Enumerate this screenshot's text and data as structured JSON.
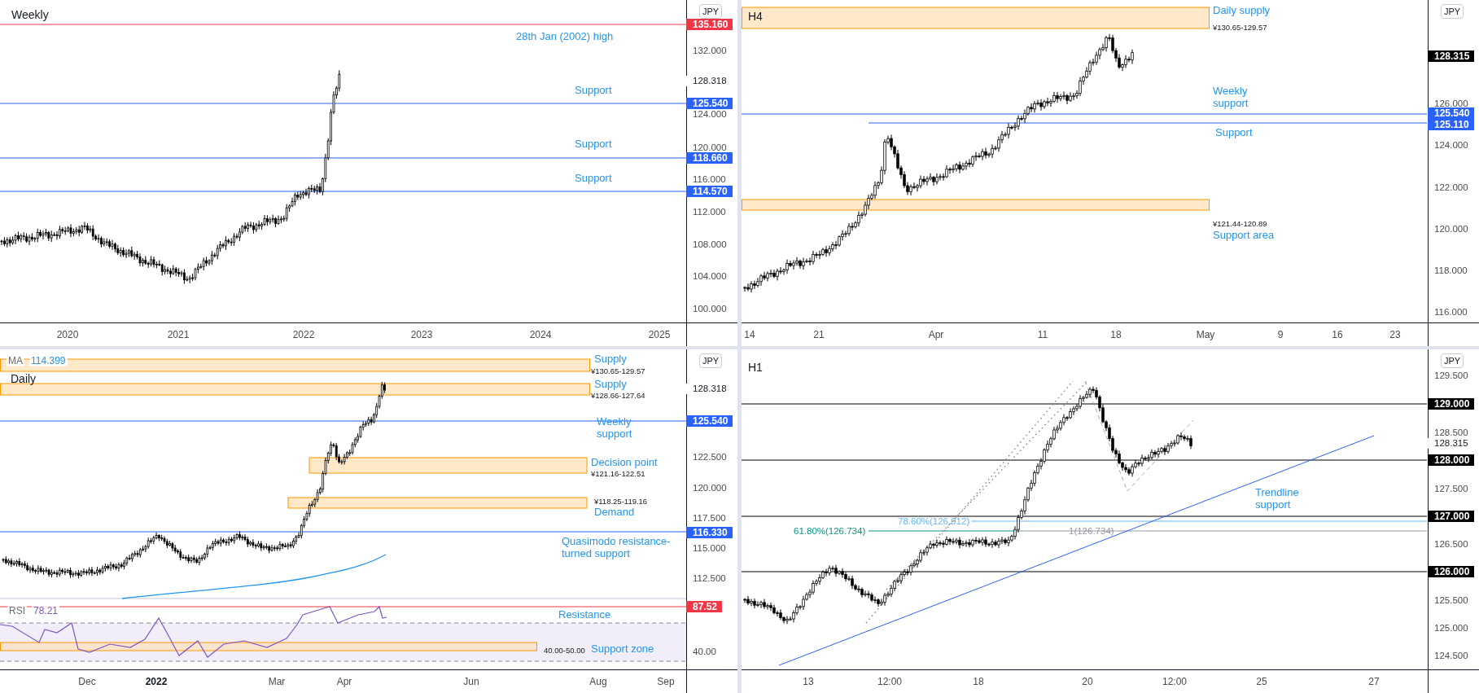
{
  "panels": [
    {
      "timeframe": "Weekly",
      "currency": "JPY",
      "price_axis": [
        {
          "label": "135.160",
          "kind": "badge",
          "color": "#f23645"
        },
        {
          "label": "132.000",
          "kind": "tick"
        },
        {
          "label": "128.318",
          "kind": "last"
        },
        {
          "label": "125.540",
          "kind": "badge",
          "color": "#2962ff"
        },
        {
          "label": "124.000",
          "kind": "tick"
        },
        {
          "label": "120.000",
          "kind": "tick"
        },
        {
          "label": "118.660",
          "kind": "badge",
          "color": "#2962ff"
        },
        {
          "label": "116.000",
          "kind": "tick"
        },
        {
          "label": "114.570",
          "kind": "badge",
          "color": "#2962ff"
        },
        {
          "label": "112.000",
          "kind": "tick"
        },
        {
          "label": "108.000",
          "kind": "tick"
        },
        {
          "label": "104.000",
          "kind": "tick"
        },
        {
          "label": "100.000",
          "kind": "tick"
        }
      ],
      "annotations": [
        {
          "text": "28th Jan (2002) high",
          "kind": "label"
        },
        {
          "text": "Support",
          "kind": "label"
        },
        {
          "text": "Support",
          "kind": "label"
        },
        {
          "text": "Support",
          "kind": "label"
        }
      ],
      "time_axis": [
        {
          "label": "2020",
          "kind": "minor"
        },
        {
          "label": "2021",
          "kind": "minor"
        },
        {
          "label": "2022",
          "kind": "minor"
        },
        {
          "label": "2023",
          "kind": "minor"
        },
        {
          "label": "2024",
          "kind": "minor"
        },
        {
          "label": "2025",
          "kind": "minor"
        }
      ]
    },
    {
      "timeframe": "H4",
      "currency": "JPY",
      "price_axis": [
        {
          "label": "128.315",
          "kind": "badge",
          "color": "#000000"
        },
        {
          "label": "126.000",
          "kind": "tick"
        },
        {
          "label": "125.540",
          "kind": "badge",
          "color": "#2962ff"
        },
        {
          "label": "125.110",
          "kind": "badge",
          "color": "#2962ff"
        },
        {
          "label": "124.000",
          "kind": "tick"
        },
        {
          "label": "122.000",
          "kind": "tick"
        },
        {
          "label": "120.000",
          "kind": "tick"
        },
        {
          "label": "118.000",
          "kind": "tick"
        },
        {
          "label": "116.000",
          "kind": "tick"
        }
      ],
      "annotations": [
        {
          "text": "Daily supply",
          "kind": "label"
        },
        {
          "text": "¥130.65-129.57",
          "kind": "note"
        },
        {
          "text": "Weekly support",
          "kind": "label"
        },
        {
          "text": "Support",
          "kind": "label"
        },
        {
          "text": "¥121.44-120.89",
          "kind": "note"
        },
        {
          "text": "Support area",
          "kind": "label"
        }
      ],
      "time_axis": [
        {
          "label": "14",
          "kind": "minor"
        },
        {
          "label": "21",
          "kind": "minor"
        },
        {
          "label": "Apr",
          "kind": "minor"
        },
        {
          "label": "11",
          "kind": "minor"
        },
        {
          "label": "18",
          "kind": "minor"
        },
        {
          "label": "May",
          "kind": "minor"
        },
        {
          "label": "9",
          "kind": "minor"
        },
        {
          "label": "16",
          "kind": "minor"
        },
        {
          "label": "23",
          "kind": "minor"
        }
      ]
    },
    {
      "timeframe": "Daily",
      "currency": "JPY",
      "indicators": [
        {
          "name": "MA",
          "value": "114.399",
          "color": "#2196f3"
        },
        {
          "name": "RSI",
          "value": "78.21",
          "color": "#7e57c2"
        }
      ],
      "price_axis": [
        {
          "label": "128.318",
          "kind": "last"
        },
        {
          "label": "125.540",
          "kind": "badge",
          "color": "#2962ff"
        },
        {
          "label": "122.500",
          "kind": "tick"
        },
        {
          "label": "120.000",
          "kind": "tick"
        },
        {
          "label": "117.500",
          "kind": "tick"
        },
        {
          "label": "116.330",
          "kind": "badge",
          "color": "#2962ff"
        },
        {
          "label": "115.000",
          "kind": "tick"
        },
        {
          "label": "112.500",
          "kind": "tick"
        },
        {
          "label": "87.52",
          "kind": "badge",
          "color": "#f23645"
        },
        {
          "label": "40.00",
          "kind": "tick"
        }
      ],
      "annotations": [
        {
          "text": "Supply",
          "kind": "label"
        },
        {
          "text": "¥130.65-129.57",
          "kind": "note"
        },
        {
          "text": "Supply",
          "kind": "label"
        },
        {
          "text": "¥128.66-127.64",
          "kind": "note"
        },
        {
          "text": "Weekly support",
          "kind": "label"
        },
        {
          "text": "Decision point",
          "kind": "label"
        },
        {
          "text": "¥121.16-122.51",
          "kind": "note"
        },
        {
          "text": "¥118.25-119.16",
          "kind": "note"
        },
        {
          "text": "Demand",
          "kind": "label"
        },
        {
          "text": "Quasimodo resistance-turned support",
          "kind": "label"
        },
        {
          "text": "Resistance",
          "kind": "label"
        },
        {
          "text": "40.00-50.00",
          "kind": "note"
        },
        {
          "text": "Support zone",
          "kind": "label"
        }
      ],
      "time_axis": [
        {
          "label": "Dec",
          "kind": "minor"
        },
        {
          "label": "2022",
          "kind": "major"
        },
        {
          "label": "Mar",
          "kind": "minor"
        },
        {
          "label": "Apr",
          "kind": "minor"
        },
        {
          "label": "Jun",
          "kind": "minor"
        },
        {
          "label": "Aug",
          "kind": "minor"
        },
        {
          "label": "Sep",
          "kind": "minor"
        }
      ]
    },
    {
      "timeframe": "H1",
      "currency": "JPY",
      "price_axis": [
        {
          "label": "129.500",
          "kind": "tick"
        },
        {
          "label": "129.000",
          "kind": "badge",
          "color": "#000000"
        },
        {
          "label": "128.500",
          "kind": "tick"
        },
        {
          "label": "128.315",
          "kind": "last"
        },
        {
          "label": "128.000",
          "kind": "badge",
          "color": "#000000"
        },
        {
          "label": "127.500",
          "kind": "tick"
        },
        {
          "label": "127.000",
          "kind": "badge",
          "color": "#000000"
        },
        {
          "label": "126.500",
          "kind": "tick"
        },
        {
          "label": "126.000",
          "kind": "badge",
          "color": "#000000"
        },
        {
          "label": "125.500",
          "kind": "tick"
        },
        {
          "label": "125.000",
          "kind": "tick"
        },
        {
          "label": "124.500",
          "kind": "tick"
        }
      ],
      "annotations": [
        {
          "text": "78.60%(126.912)",
          "kind": "fib",
          "color": "#64b5f6"
        },
        {
          "text": "61.80%(126.734)",
          "kind": "fib",
          "color": "#089981"
        },
        {
          "text": "1(126.734)",
          "kind": "fib",
          "color": "#9598a1"
        },
        {
          "text": "Trendline support",
          "kind": "label"
        }
      ],
      "time_axis": [
        {
          "label": "13",
          "kind": "minor"
        },
        {
          "label": "12:00",
          "kind": "minor"
        },
        {
          "label": "18",
          "kind": "minor"
        },
        {
          "label": "20",
          "kind": "minor"
        },
        {
          "label": "12:00",
          "kind": "minor"
        },
        {
          "label": "25",
          "kind": "minor"
        },
        {
          "label": "27",
          "kind": "minor"
        }
      ]
    }
  ]
}
